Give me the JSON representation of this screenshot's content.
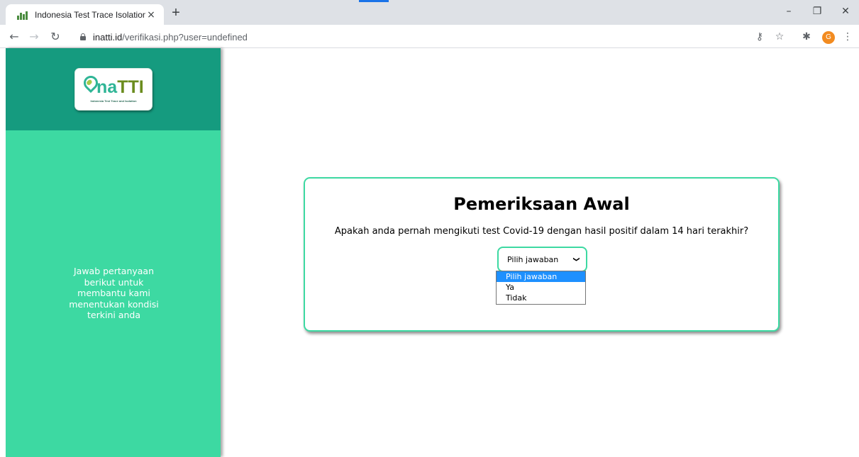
{
  "browser": {
    "tab_title": "Indonesia Test Trace Isolation",
    "tab_close": "×",
    "new_tab": "+",
    "url_host": "inatti.id",
    "url_path": "/verifikasi.php?user=undefined",
    "profile_initial": "G",
    "accent_color": "#1a73e8"
  },
  "sidebar": {
    "logo_na": "na",
    "logo_tti": "TTI",
    "logo_subtitle": "Indonesia Test Trace and Isolation",
    "message": "Jawab pertanyaan berikut untuk membantu kami menentukan kondisi terkini anda",
    "colors": {
      "top": "#159b7f",
      "body": "#3dd9a2"
    }
  },
  "main": {
    "title": "Pemeriksaan Awal",
    "question": "Apakah anda pernah mengikuti test Covid-19 dengan hasil positif dalam 14 hari terakhir?",
    "select": {
      "value": "Pilih jawaban",
      "options": [
        "Pilih jawaban",
        "Ya",
        "Tidak"
      ],
      "highlighted_index": 0
    }
  }
}
